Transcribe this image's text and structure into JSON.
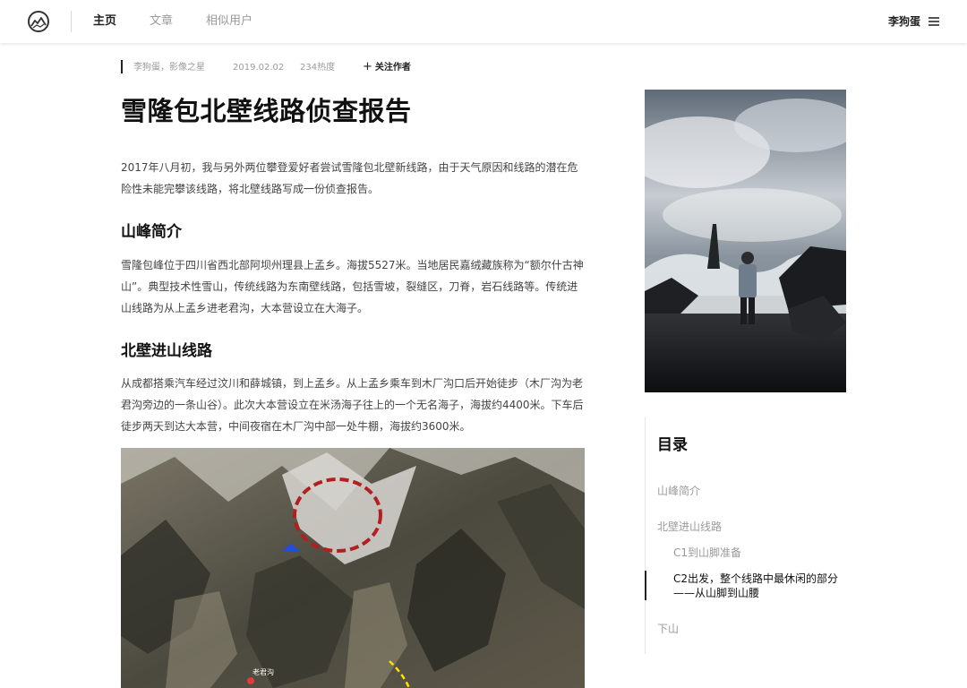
{
  "nav": {
    "items": [
      {
        "label": "主页"
      },
      {
        "label": "文章"
      },
      {
        "label": "相似用户"
      }
    ],
    "user_name": "李狗蛋"
  },
  "article": {
    "meta": {
      "author": "李狗蛋，影像之星",
      "date": "2019.02.02",
      "heat": "234热度",
      "follow_label": "关注作者"
    },
    "title": "雪隆包北壁线路侦查报告",
    "intro": "2017年八月初，我与另外两位攀登爱好者尝试雪隆包北壁新线路，由于天气原因和线路的潜在危险性未能完攀该线路，将北壁线路写成一份侦查报告。",
    "sections": [
      {
        "heading": "山峰简介",
        "body": "雪隆包峰位于四川省西北部阿坝州理县上孟乡。海拔5527米。当地居民嘉绒藏族称为“额尔什古神山”。典型技术性雪山，传统线路为东南壁线路，包括雪坡，裂缝区，刀脊，岩石线路等。传统进山线路为从上孟乡进老君沟，大本营设立在大海子。"
      },
      {
        "heading": "北壁进山线路",
        "body": "从成都搭乘汽车经过汶川和薛城镇，到上孟乡。从上孟乡乘车到木厂沟口后开始徒步（木厂沟为老君沟旁边的一条山谷）。此次大本营设立在米汤海子往上的一个无名海子，海拔约4400米。下车后徒步两天到达大本营，中间夜宿在木厂沟中部一处牛棚，海拔约3600米。"
      }
    ],
    "map_label": "老君沟"
  },
  "toc": {
    "title": "目录",
    "items": [
      {
        "label": "山峰简介"
      },
      {
        "label": "北壁进山线路"
      },
      {
        "label": "C1到山脚准备"
      },
      {
        "label": "C2出发，整个线路中最休闲的部分——从山脚到山腰"
      },
      {
        "label": "下山"
      }
    ]
  }
}
